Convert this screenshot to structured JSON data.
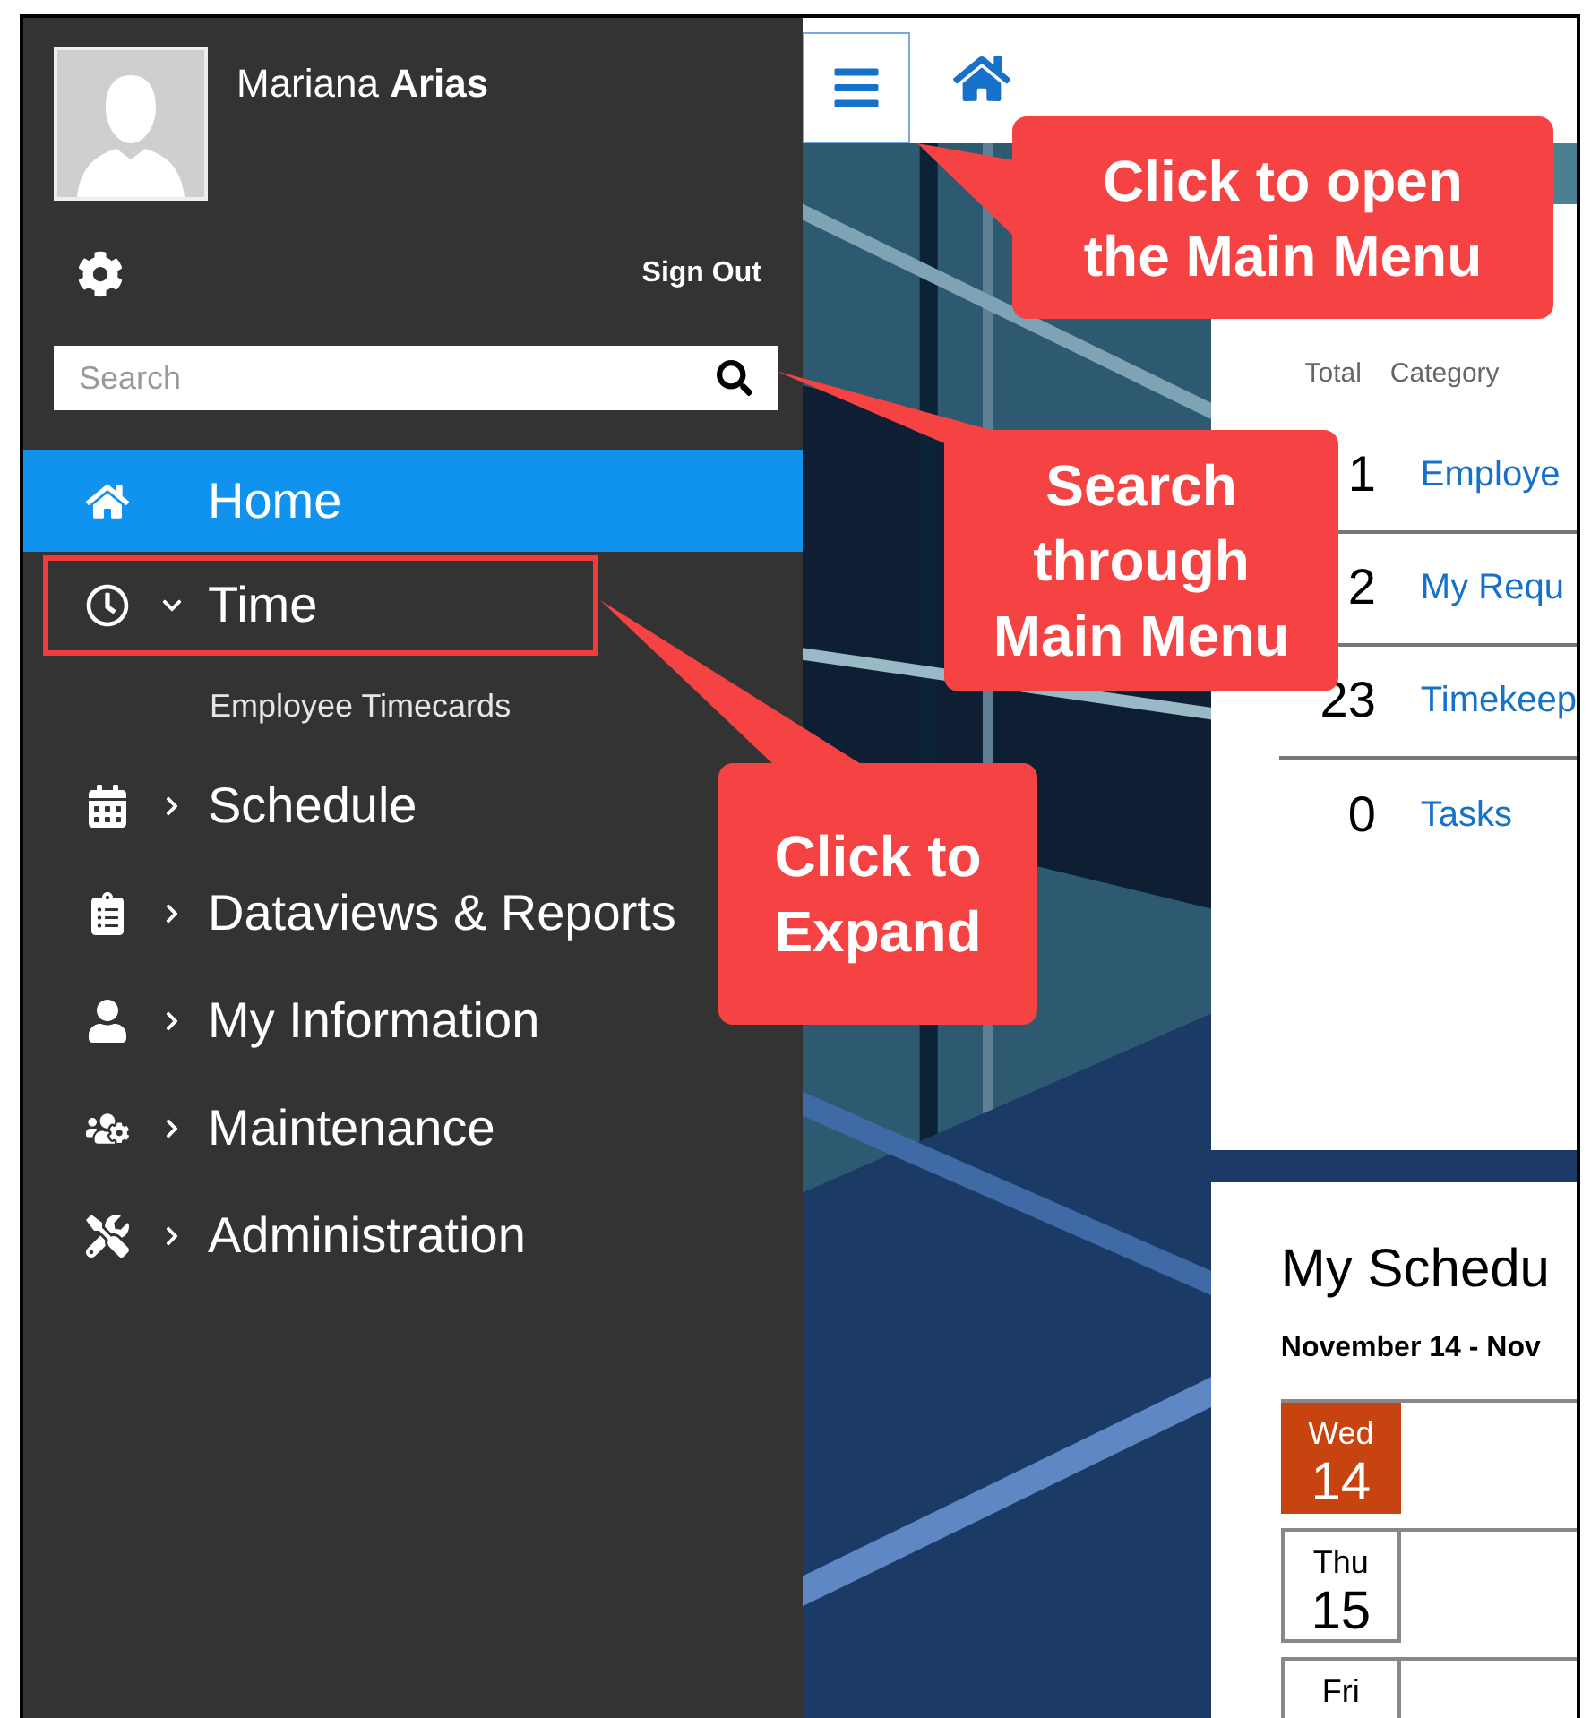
{
  "user": {
    "name": "Mariana **Arias**"
  },
  "sign_out": "Sign Out",
  "search": {
    "placeholder": "Search"
  },
  "menu": [
    {
      "label": "Home",
      "kind": "home",
      "selected": true,
      "highlighted": false
    },
    {
      "label": "Time",
      "kind": "clock",
      "selected": false,
      "highlighted": true,
      "expanded": true,
      "children": [
        {
          "label": "Employee Timecards"
        }
      ]
    },
    {
      "label": "Schedule",
      "kind": "calendar",
      "selected": false,
      "highlighted": false,
      "expanded": false
    },
    {
      "label": "Dataviews & Reports",
      "kind": "clipboard",
      "selected": false,
      "highlighted": false,
      "expanded": false
    },
    {
      "label": "My Information",
      "kind": "user",
      "selected": false,
      "highlighted": false,
      "expanded": false
    },
    {
      "label": "Maintenance",
      "kind": "users-gear",
      "selected": false,
      "highlighted": false,
      "expanded": false
    },
    {
      "label": "Administration",
      "kind": "tools",
      "selected": false,
      "highlighted": false,
      "expanded": false
    }
  ],
  "notifications": {
    "columns": [
      "Total",
      "Category"
    ],
    "rows": [
      {
        "total": "1",
        "category": "Employe"
      },
      {
        "total": "2",
        "category": "My Requ"
      },
      {
        "total": "23",
        "category": "Timekeep"
      },
      {
        "total": "0",
        "category": "Tasks"
      }
    ]
  },
  "schedule": {
    "title": "My Schedu",
    "range": "November 14 - Nov",
    "days": [
      {
        "day": "Wed",
        "date": "14",
        "selected": true
      },
      {
        "day": "Thu",
        "date": "15",
        "selected": false
      },
      {
        "day": "Fri",
        "selected": false
      }
    ]
  },
  "callouts": [
    {
      "lines": [
        "Click to open",
        "the Main Menu"
      ]
    },
    {
      "lines": [
        "Search",
        "through",
        "Main Menu"
      ]
    },
    {
      "lines": [
        "Click to",
        "Expand"
      ]
    }
  ]
}
